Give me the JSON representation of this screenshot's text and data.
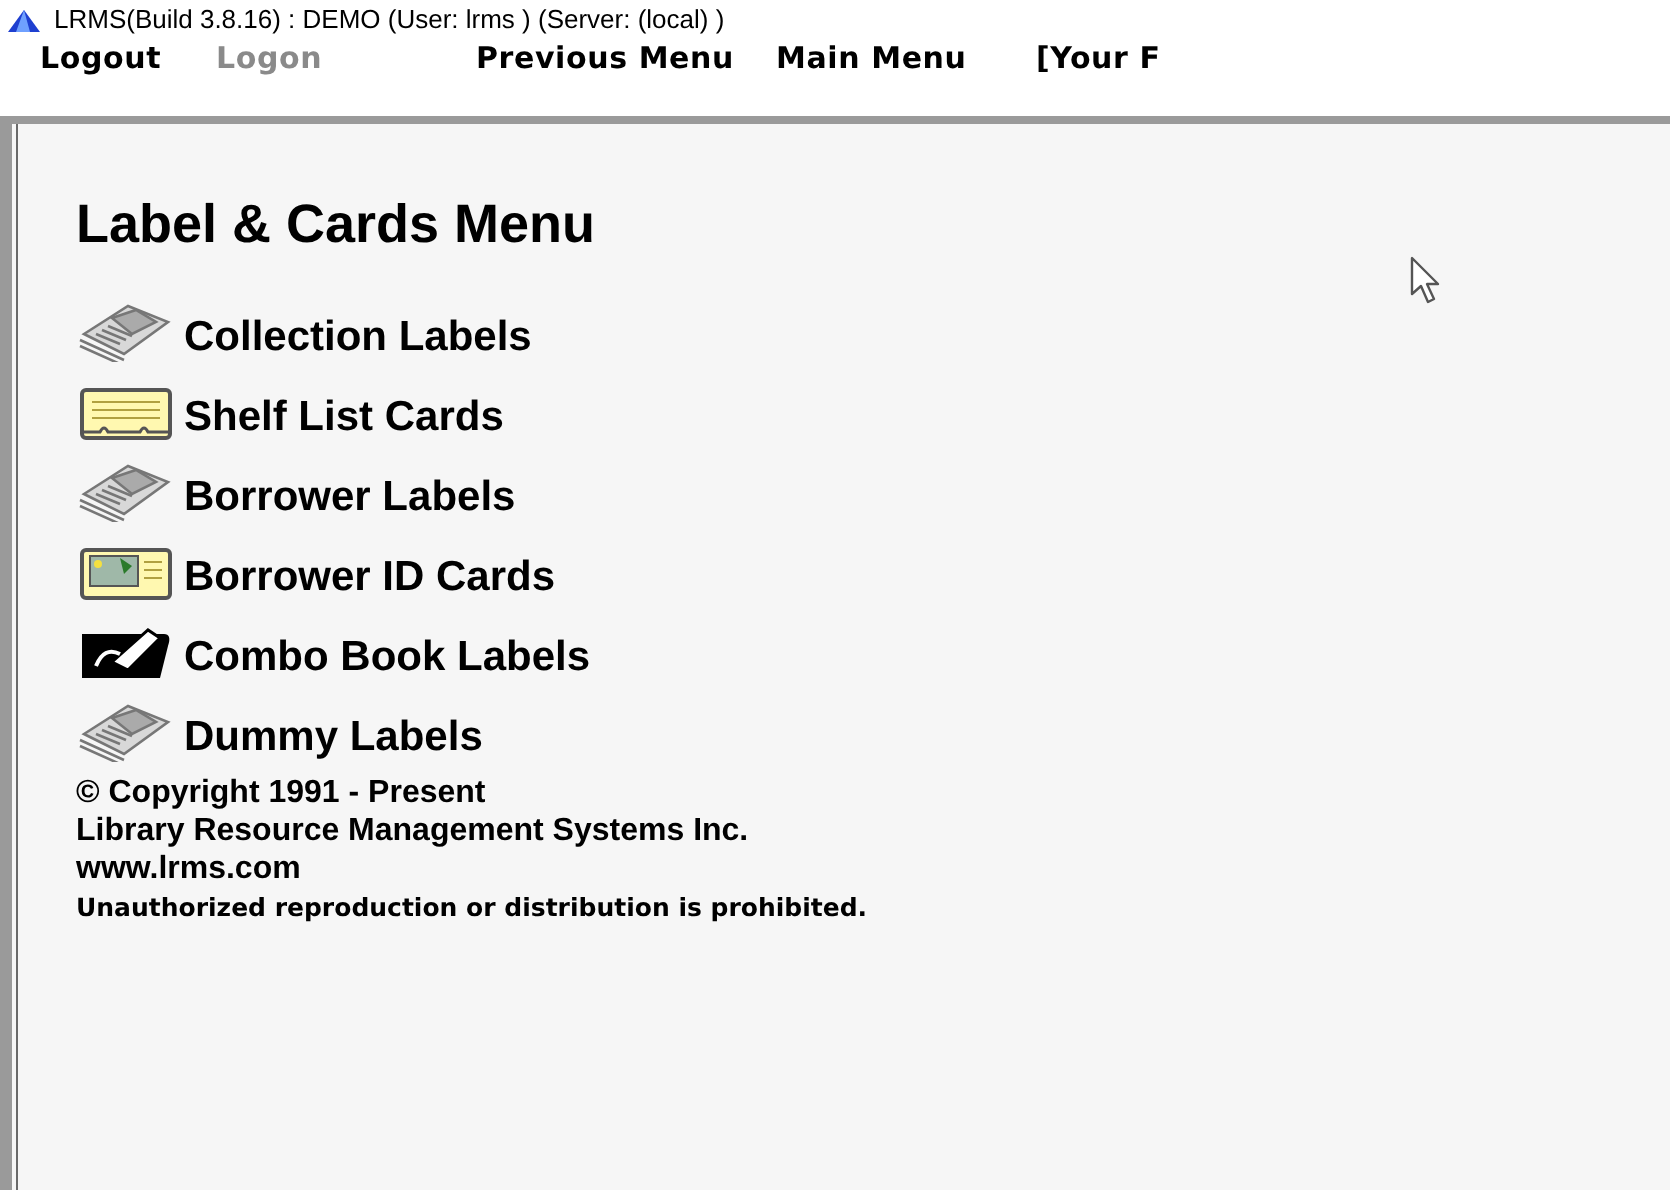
{
  "window": {
    "title": "LRMS(Build 3.8.16) : DEMO (User: lrms ) (Server: (local) )"
  },
  "menu": [
    {
      "label": "Logout",
      "disabled": false
    },
    {
      "label": "Logon",
      "disabled": true
    },
    {
      "label": "Previous Menu",
      "disabled": false
    },
    {
      "label": "Main Menu",
      "disabled": false
    },
    {
      "label": "[Your F",
      "disabled": false
    }
  ],
  "heading": "Label & Cards Menu",
  "items": [
    {
      "label": "Collection Labels",
      "kind": "label"
    },
    {
      "label": "Shelf List Cards",
      "kind": "card"
    },
    {
      "label": "Borrower Labels",
      "kind": "label"
    },
    {
      "label": "Borrower ID Cards",
      "kind": "idcard"
    },
    {
      "label": "Combo Book Labels",
      "kind": "combo"
    },
    {
      "label": "Dummy Labels",
      "kind": "label"
    }
  ],
  "footer": [
    "© Copyright 1991 - Present",
    "Library Resource Management Systems Inc.",
    "www.lrms.com",
    "Unauthorized reproduction or distribution is prohibited."
  ]
}
